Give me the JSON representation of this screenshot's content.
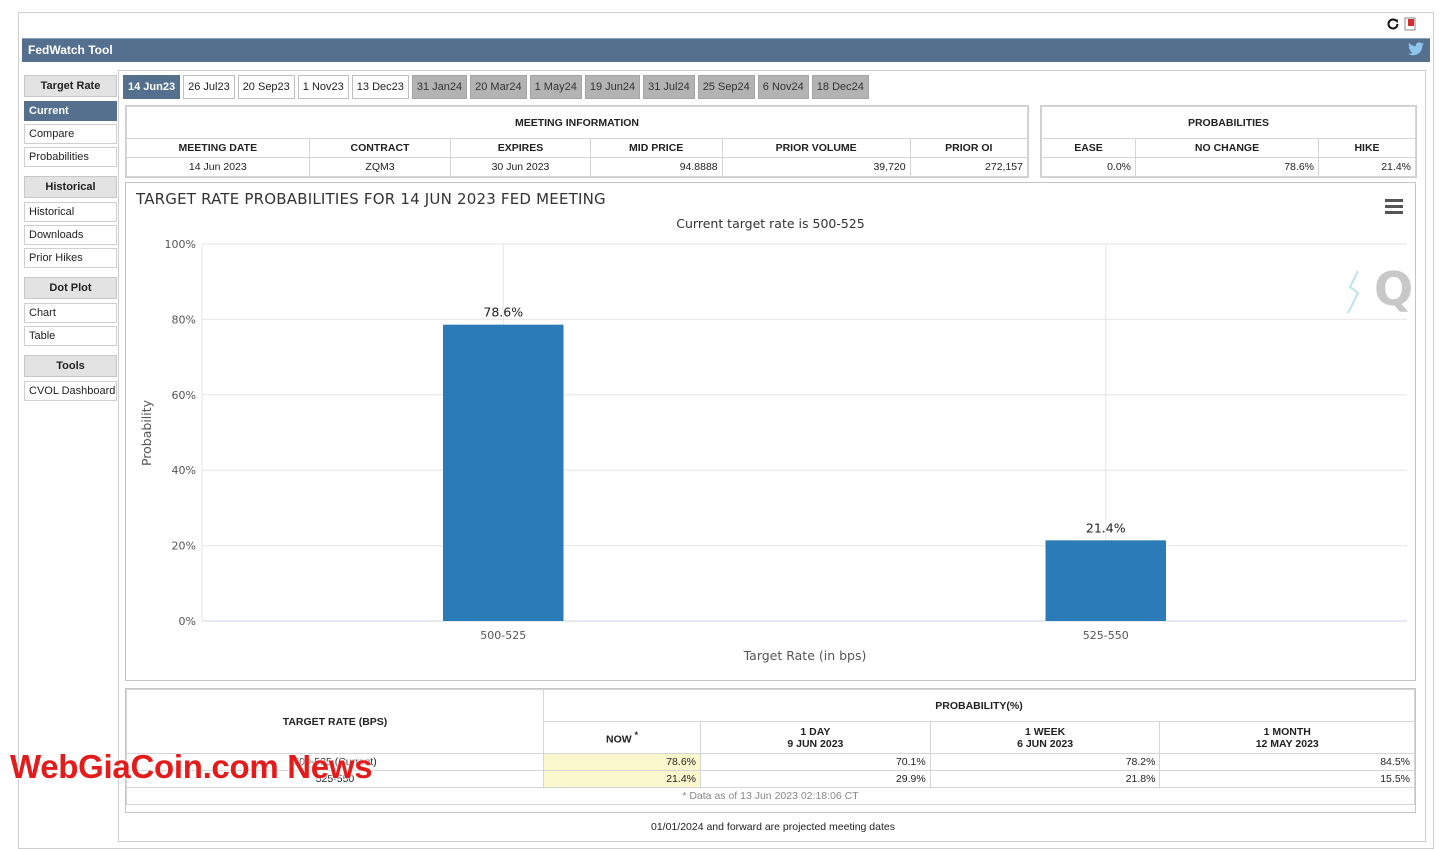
{
  "app": {
    "title": "FedWatch Tool"
  },
  "sidebar": {
    "sections": [
      {
        "heading": "Target Rate",
        "items": [
          "Current",
          "Compare",
          "Probabilities"
        ]
      },
      {
        "heading": "Historical",
        "items": [
          "Historical",
          "Downloads",
          "Prior Hikes"
        ]
      },
      {
        "heading": "Dot Plot",
        "items": [
          "Chart",
          "Table"
        ]
      },
      {
        "heading": "Tools",
        "items": [
          "CVOL Dashboard"
        ]
      }
    ]
  },
  "tabs": [
    "14 Jun23",
    "26 Jul23",
    "20 Sep23",
    "1 Nov23",
    "13 Dec23",
    "31 Jan24",
    "20 Mar24",
    "1 May24",
    "19 Jun24",
    "31 Jul24",
    "25 Sep24",
    "6 Nov24",
    "18 Dec24"
  ],
  "meeting_info": {
    "heading": "MEETING INFORMATION",
    "columns": [
      "MEETING DATE",
      "CONTRACT",
      "EXPIRES",
      "MID PRICE",
      "PRIOR VOLUME",
      "PRIOR OI"
    ],
    "values": [
      "14 Jun 2023",
      "ZQM3",
      "30 Jun 2023",
      "94.8888",
      "39,720",
      "272,157"
    ]
  },
  "probabilities": {
    "heading": "PROBABILITIES",
    "columns": [
      "EASE",
      "NO CHANGE",
      "HIKE"
    ],
    "values": [
      "0.0%",
      "78.6%",
      "21.4%"
    ]
  },
  "chart_data": {
    "type": "bar",
    "title": "TARGET RATE PROBABILITIES FOR 14 JUN 2023 FED MEETING",
    "subtitle": "Current target rate is 500-525",
    "categories": [
      "500-525",
      "525-550"
    ],
    "values": [
      78.6,
      21.4
    ],
    "data_labels": [
      "78.6%",
      "21.4%"
    ],
    "xlabel": "Target Rate (in bps)",
    "ylabel": "Probability",
    "yticks": [
      "0%",
      "20%",
      "40%",
      "60%",
      "80%",
      "100%"
    ],
    "ylim": [
      0,
      100
    ],
    "grid": true,
    "color": "#2b7bb9"
  },
  "prob_table": {
    "rate_header": "TARGET RATE (BPS)",
    "prob_header": "PROBABILITY(%)",
    "cols": [
      {
        "line1": "NOW",
        "line2": ""
      },
      {
        "line1": "1 DAY",
        "line2": "9 JUN 2023"
      },
      {
        "line1": "1 WEEK",
        "line2": "6 JUN 2023"
      },
      {
        "line1": "1 MONTH",
        "line2": "12 MAY 2023"
      }
    ],
    "rows": [
      {
        "rate": "500-525 (Current)",
        "vals": [
          "78.6%",
          "70.1%",
          "78.2%",
          "84.5%"
        ]
      },
      {
        "rate": "525-550",
        "vals": [
          "21.4%",
          "29.9%",
          "21.8%",
          "15.5%"
        ]
      }
    ],
    "note": "* Data as of 13 Jun 2023 02:18:06 CT"
  },
  "footnote": "01/01/2024 and forward are projected meeting dates",
  "watermark": "WebGiaCoin.com News"
}
